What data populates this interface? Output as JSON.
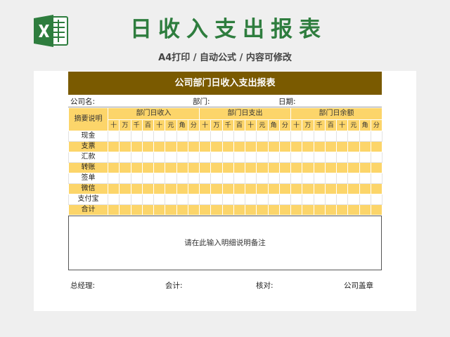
{
  "app_icon": "excel-icon",
  "banner": {
    "title": "日收入支出报表",
    "subtitle": "A4打印 / 自动公式 / 内容可修改"
  },
  "document": {
    "header": "公司部门日收入支出报表",
    "info": {
      "company_label": "公司名:",
      "department_label": "部门:",
      "date_label": "日期:"
    },
    "table": {
      "summary_header": "摘要说明",
      "groups": [
        "部门日收入",
        "部门日支出",
        "部门日余额"
      ],
      "digit_headers": [
        "十",
        "万",
        "千",
        "百",
        "十",
        "元",
        "角",
        "分"
      ],
      "rows": [
        "现金",
        "支票",
        "汇款",
        "转账",
        "签单",
        "微信",
        "支付宝",
        "合计"
      ]
    },
    "notes_placeholder": "请在此输入明细说明备注",
    "signatures": {
      "manager": "总经理:",
      "accountant": "会计:",
      "auditor": "核对:",
      "seal": "公司盖章"
    }
  },
  "colors": {
    "title_green": "#2e7d3e",
    "header_brown": "#7a5a00",
    "row_yellow": "#fcd56a"
  }
}
